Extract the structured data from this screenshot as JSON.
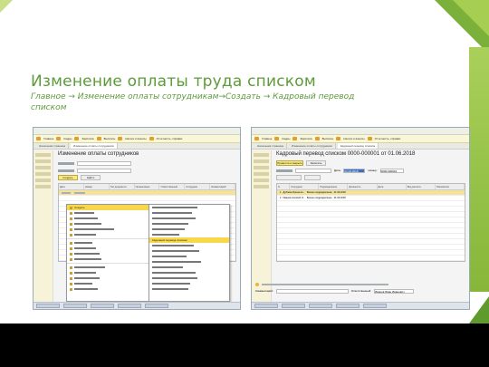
{
  "slide": {
    "title": "Изменение оплаты труда списком",
    "subtitle": "Главное → Изменение оплаты сотрудникам→Создать → Кадровый перевод списком"
  },
  "left_window": {
    "titlebar": "",
    "toolbar": [
      "Главное",
      "Кадры",
      "Зарплата",
      "Выплаты",
      "Налоги и взносы",
      "Отчетность, справки",
      "Настройка",
      "Администрирование"
    ],
    "tabs": [
      "Начальная страница",
      "Изменение оплаты сотрудников"
    ],
    "form_title": "Изменение оплаты сотрудников",
    "create_button": "Создать",
    "find_button": "Найти",
    "grid_headers": [
      "Дата",
      "Номер",
      "Тип документа",
      "Организация",
      "Ответственный",
      "Сотрудник",
      "Комментарий"
    ],
    "menu_first_item": "Создать",
    "menu_highlight": "Кадровый перевод списком"
  },
  "right_window": {
    "titlebar": "",
    "toolbar": [
      "Главное",
      "Кадры",
      "Зарплата",
      "Выплаты",
      "Налоги и взносы",
      "Отчетность, справки",
      "Настройка",
      "Администрирование"
    ],
    "tabs": [
      "Начальная страница",
      "Изменение оплаты сотрудников",
      "Кадровый перевод списком"
    ],
    "form_title": "Кадровый перевод списком 0000-000001 от 01.06.2018",
    "post_close_button": "Провести и закрыть",
    "save_button": "Записать",
    "date_label": "Дата:",
    "date_value": "01.06.2018",
    "number_label": "Номер:",
    "number_value": "0000-000001",
    "grid_headers": [
      "N",
      "Сотрудник",
      "Подразделение",
      "Должность",
      "Дата",
      "Вид расчета",
      "Показатели"
    ],
    "rows": [
      {
        "n": "1",
        "employee": "Дубовик Ирина Ан...",
        "dept": "Бизнес-подразделение",
        "date": "01.06.2018"
      },
      {
        "n": "2",
        "employee": "Иванов Алексей Э...",
        "dept": "Бизнес-подразделение",
        "date": "01.06.2018"
      }
    ],
    "responsible_label": "Ответственный:",
    "responsible_value": "Иванов Иван Иванович",
    "comment_label": "Комментарий:"
  }
}
